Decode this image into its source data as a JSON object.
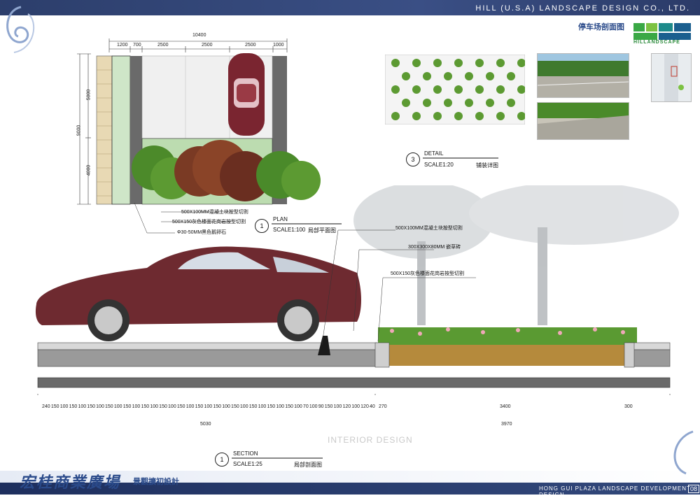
{
  "header": {
    "firm": "HILL (U.S.A) LANDSCAPE  DESIGN CO., LTD.",
    "sheet_title": "停车场剖面图",
    "logo_text": "HILLANDSCAPE"
  },
  "plan": {
    "dims_top": [
      "1200",
      "700",
      "2500",
      "2500",
      "2500",
      "1000"
    ],
    "overall_width": "10400",
    "dims_left": [
      "5000",
      "4000"
    ],
    "overall_height": "9000",
    "labels": [
      "500X100MM混凝土块按型切割",
      "500X150灰色楼面花岗岩按型切割",
      "Φ30-50MM黑色鹅卵石"
    ],
    "number": "1",
    "title": "PLAN",
    "scale": "SCALE1:100",
    "cn": "局部平面图"
  },
  "detail": {
    "number": "3",
    "title": "DETAIL",
    "scale": "SCALE1:20",
    "cn": "铺装详图"
  },
  "section": {
    "labels": [
      "500X100MM混凝土块按型切割",
      "300X300X80MM 嵌草砖",
      "500X150灰色楼面花岗岩按型切割"
    ],
    "dims_bottom_left": [
      "240",
      "150",
      "100",
      "150",
      "100",
      "150",
      "100",
      "150",
      "100",
      "150",
      "100",
      "150",
      "100",
      "150",
      "100",
      "150",
      "100",
      "150",
      "100",
      "150",
      "100",
      "150",
      "100",
      "150",
      "100",
      "150",
      "100",
      "150",
      "100",
      "70",
      "100",
      "90",
      "150",
      "100",
      "120",
      "100",
      "120",
      "40"
    ],
    "dims_bottom_right": [
      "270",
      "3400",
      "300"
    ],
    "total_left": "5030",
    "total_right": "3970",
    "number": "1",
    "title": "SECTION",
    "scale": "SCALE1:25",
    "cn": "局部剖面图"
  },
  "footer": {
    "project_cn": "宏桂商業廣場",
    "project_sub": "景觀擴初設計",
    "project_en": "HONG  GUI  PLAZA  LANDSCAPE DEVELOPMENT DESIGN",
    "page": "08"
  },
  "watermark": "INTERIOR DESIGN",
  "colors": {
    "header": "#2c3e6b",
    "car": "#6e2a30",
    "foliage": "#4a8a2a",
    "soil": "#b58a3c"
  }
}
